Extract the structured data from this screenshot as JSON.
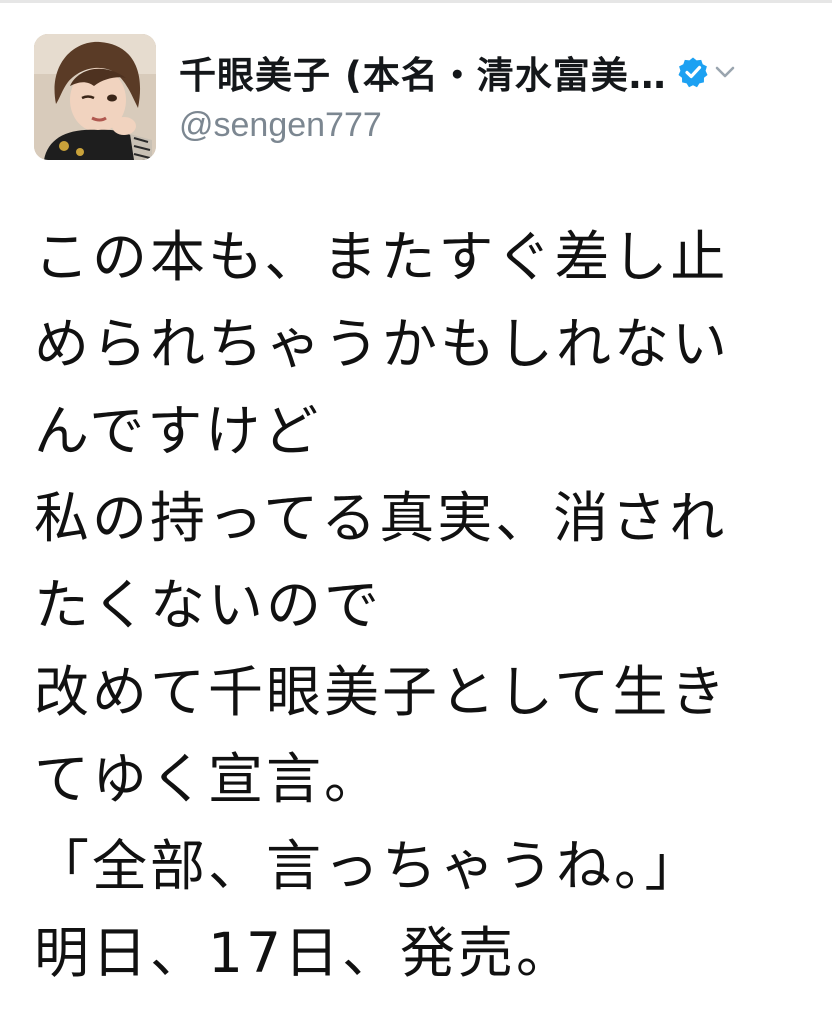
{
  "tweet": {
    "author": {
      "display_name": "千眼美子 (本名・清水富美…",
      "handle": "@sengen777",
      "verified_icon": "verified-badge-icon",
      "menu_icon": "chevron-down-icon"
    },
    "lines": [
      "この本も、またすぐ差し止",
      "められちゃうかもしれない",
      "んですけど",
      "私の持ってる真実、消され",
      "たくないので",
      "改めて千眼美子として生き",
      "てゆく宣言。",
      "「全部、言っちゃうね。」",
      "明日、17日、発売。"
    ]
  },
  "colors": {
    "verified": "#1da1f2",
    "handle": "#7c8791",
    "text": "#111111"
  }
}
